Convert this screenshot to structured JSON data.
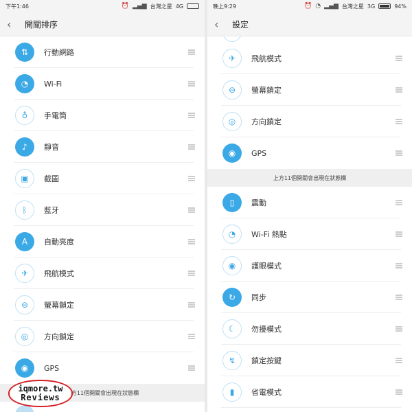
{
  "left": {
    "status": {
      "time": "下午1:46",
      "carrier": "台灣之星",
      "network": "4G"
    },
    "header": {
      "back": "‹",
      "title": "開關排序"
    },
    "items": [
      {
        "label": "行動網路",
        "icon": "⇅",
        "icon_name": "mobile-data-icon",
        "on": true
      },
      {
        "label": "Wi-Fi",
        "icon": "◔",
        "icon_name": "wifi-icon",
        "on": true
      },
      {
        "label": "手電筒",
        "icon": "♁",
        "icon_name": "flashlight-icon",
        "on": false
      },
      {
        "label": "靜音",
        "icon": "♪",
        "icon_name": "mute-icon",
        "on": true
      },
      {
        "label": "截圖",
        "icon": "▣",
        "icon_name": "screenshot-icon",
        "on": false
      },
      {
        "label": "藍牙",
        "icon": "ᛒ",
        "icon_name": "bluetooth-icon",
        "on": false
      },
      {
        "label": "自動亮度",
        "icon": "A",
        "icon_name": "auto-brightness-icon",
        "on": true
      },
      {
        "label": "飛航模式",
        "icon": "✈",
        "icon_name": "airplane-icon",
        "on": false
      },
      {
        "label": "螢幕鎖定",
        "icon": "⊖",
        "icon_name": "lock-icon",
        "on": false
      },
      {
        "label": "方向鎖定",
        "icon": "◎",
        "icon_name": "rotation-lock-icon",
        "on": false
      },
      {
        "label": "GPS",
        "icon": "◉",
        "icon_name": "gps-icon",
        "on": true
      }
    ],
    "note": "上方11個開關會出現在狀態欄"
  },
  "right": {
    "status": {
      "time": "晚上9:29",
      "carrier": "台灣之星",
      "network": "3G",
      "battery": "94%"
    },
    "header": {
      "back": "‹",
      "title": "設定"
    },
    "items_top": [
      {
        "label": "飛航模式",
        "icon": "✈",
        "icon_name": "airplane-icon",
        "on": false
      },
      {
        "label": "螢幕鎖定",
        "icon": "⊖",
        "icon_name": "lock-icon",
        "on": false
      },
      {
        "label": "方向鎖定",
        "icon": "◎",
        "icon_name": "rotation-lock-icon",
        "on": false
      },
      {
        "label": "GPS",
        "icon": "◉",
        "icon_name": "gps-icon",
        "on": true
      }
    ],
    "note": "上方11個開關會出現在狀態欄",
    "items_bottom": [
      {
        "label": "震動",
        "icon": "▯",
        "icon_name": "vibrate-icon",
        "on": true
      },
      {
        "label": "Wi-Fi 熱點",
        "icon": "◔",
        "icon_name": "hotspot-icon",
        "on": false
      },
      {
        "label": "護眼模式",
        "icon": "◉",
        "icon_name": "eye-care-icon",
        "on": false
      },
      {
        "label": "同步",
        "icon": "↻",
        "icon_name": "sync-icon",
        "on": true
      },
      {
        "label": "勿擾模式",
        "icon": "☾",
        "icon_name": "do-not-disturb-icon",
        "on": false
      },
      {
        "label": "鎖定按鍵",
        "icon": "↯",
        "icon_name": "lock-keys-icon",
        "on": false
      },
      {
        "label": "省電模式",
        "icon": "▮",
        "icon_name": "battery-saver-icon",
        "on": false
      }
    ]
  },
  "watermark": {
    "line1": "iqmore.tw",
    "line2": "Reviews"
  },
  "colors": {
    "accent": "#3ba9e6",
    "accent_light": "#bfe0f4",
    "watermark_ring": "#d61f26"
  }
}
